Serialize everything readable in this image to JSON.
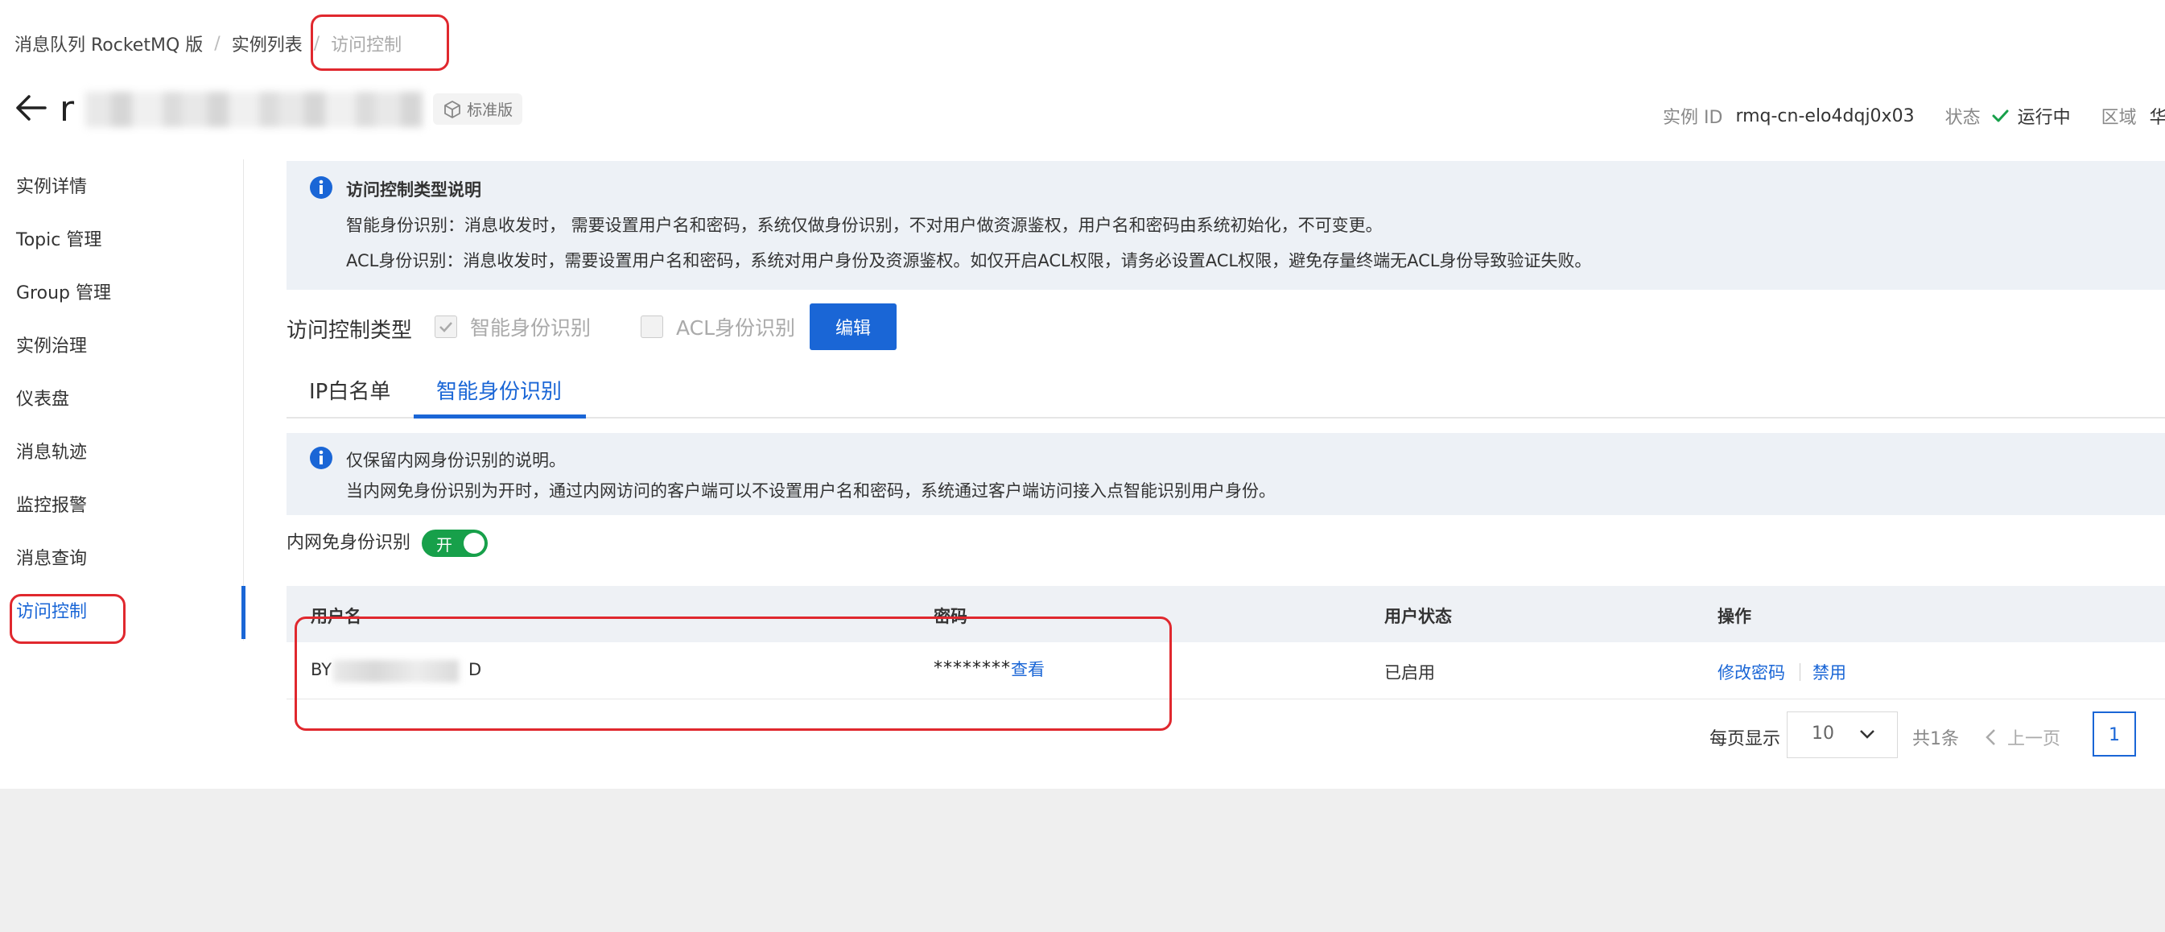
{
  "breadcrumb": {
    "items": [
      "消息队列 RocketMQ 版",
      "实例列表"
    ],
    "current": "访问控制"
  },
  "header": {
    "instance_name_prefix": "r",
    "edition_badge": "标准版",
    "instance_id_label": "实例 ID",
    "instance_id": "rmq-cn-elo4dqj0x03",
    "status_label": "状态",
    "status_value": "运行中",
    "region_label": "区域",
    "region_value": "华"
  },
  "sidebar": {
    "items": [
      {
        "label": "实例详情"
      },
      {
        "label": "Topic 管理"
      },
      {
        "label": "Group 管理"
      },
      {
        "label": "实例治理"
      },
      {
        "label": "仪表盘"
      },
      {
        "label": "消息轨迹"
      },
      {
        "label": "监控报警"
      },
      {
        "label": "消息查询"
      },
      {
        "label": "访问控制"
      }
    ],
    "active_index": 8
  },
  "notice1": {
    "title": "访问控制类型说明",
    "line1": "智能身份识别：消息收发时， 需要设置用户名和密码，系统仅做身份识别，不对用户做资源鉴权，用户名和密码由系统初始化，不可变更。",
    "line2": "ACL身份识别：消息收发时，需要设置用户名和密码，系统对用户身份及资源鉴权。如仅开启ACL权限，请务必设置ACL权限，避免存量终端无ACL身份导致验证失败。"
  },
  "access_type": {
    "label": "访问控制类型",
    "option_smart": "智能身份识别",
    "option_acl": "ACL身份识别",
    "edit_button": "编辑"
  },
  "tabs": {
    "ip_whitelist": "IP白名单",
    "smart_identity": "智能身份识别"
  },
  "notice2": {
    "line1": "仅保留内网身份识别的说明。",
    "line2": "当内网免身份识别为开时，通过内网访问的客户端可以不设置用户名和密码，系统通过客户端访问接入点智能识别用户身份。"
  },
  "toggle": {
    "label": "内网免身份识别",
    "state_text": "开"
  },
  "table": {
    "headers": {
      "username": "用户名",
      "password": "密码",
      "status": "用户状态",
      "actions": "操作"
    },
    "rows": [
      {
        "username_start": "BY",
        "username_end": "D",
        "password_mask": "********",
        "view_link": "查看",
        "status": "已启用",
        "action_modify": "修改密码",
        "action_disable": "禁用"
      }
    ]
  },
  "pagination": {
    "per_page_label": "每页显示",
    "per_page_value": "10",
    "total": "共1条",
    "prev": "上一页",
    "current_page": "1"
  },
  "colors": {
    "accent": "#1a66d6",
    "toggle_on": "#17a04a",
    "highlight_box": "#e0282e"
  }
}
